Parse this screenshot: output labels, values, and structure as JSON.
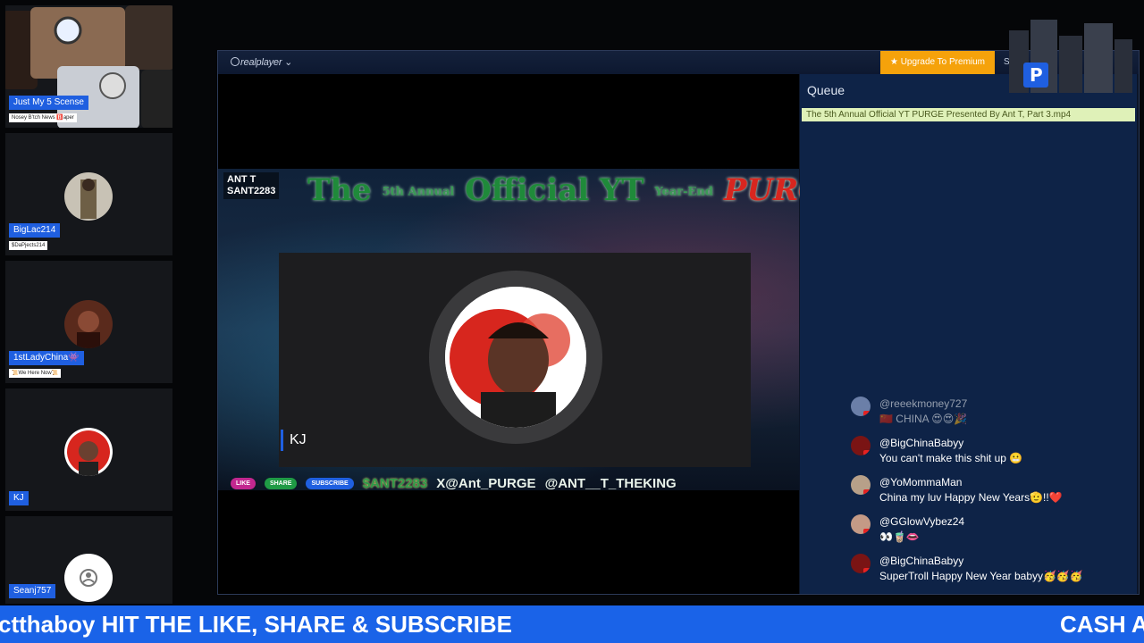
{
  "participants": [
    {
      "name": "Just My 5 Scense",
      "sub": "Nosey Bʼtch News 🅱️aper"
    },
    {
      "name": "BigLac214",
      "sub": "$DaPjects214"
    },
    {
      "name": "1stLadyChina👾",
      "sub": "📜We Here Now📜"
    },
    {
      "name": "KJ"
    },
    {
      "name": "Seanj757"
    }
  ],
  "player": {
    "brand": "realplayer",
    "upgrade_label": "★  Upgrade To Premium",
    "signin": "Sign",
    "close": "✕",
    "queue_title": "Queue",
    "queue_items": [
      "The 5th Annual Official YT PURGE Presented By Ant T, Part 3.mp4"
    ]
  },
  "video": {
    "banner_left": "ANT T\nSANT2283",
    "title_main": "The ",
    "title_small": "5th Annual",
    "title_official": " Official YT ",
    "title_small2": "Year-End",
    "title_purge": " PURGE",
    "cam_name": "KJ",
    "social": {
      "like": "LIKE",
      "share": "SHARE",
      "subscribe": "SUBSCRIBE",
      "handle1": "$ANT2283",
      "handle2": "X@Ant_PURGE",
      "handle3": "@ANT__T_THEKING"
    }
  },
  "chat": [
    {
      "user": "@reeekmoney727",
      "text": "🇨🇳 CHINA 😍😍🎉",
      "color": "#6b7fa8"
    },
    {
      "user": "@BigChinaBabyy",
      "text": "You can't make this shit up 😬",
      "color": "#7a1414"
    },
    {
      "user": "@YoMommaMan",
      "text": "China my luv Happy New Years🫡!!❤️",
      "color": "#b7a089"
    },
    {
      "user": "@GGlowVybez24",
      "text": "👀🧋👄",
      "color": "#c49a86"
    },
    {
      "user": "@BigChinaBabyy",
      "text": "SuperTroll Happy New Year babyy🥳🥳🥳",
      "color": "#7a1414"
    }
  ],
  "ticker": {
    "left": "ctthaboy HIT THE LIKE, SHARE & SUBSCRIBE",
    "right": "CASH A"
  }
}
